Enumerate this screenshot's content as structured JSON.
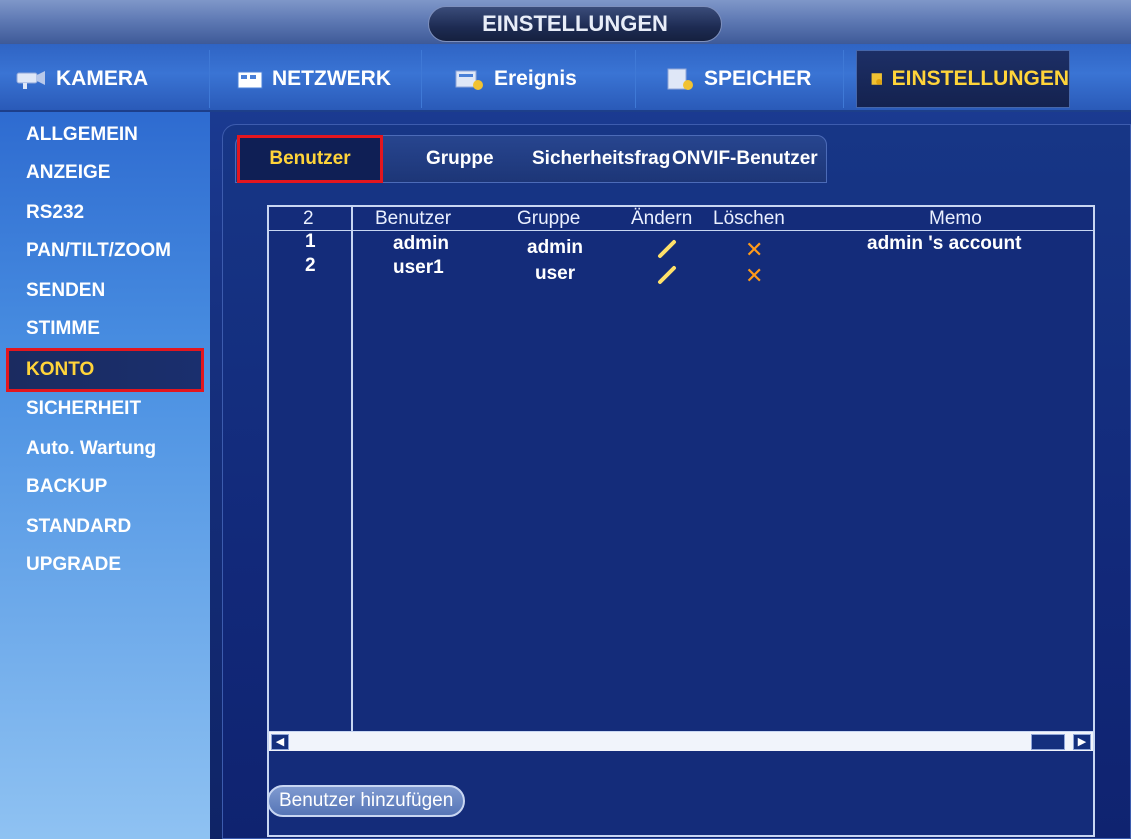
{
  "window": {
    "title": "EINSTELLUNGEN"
  },
  "main_nav": [
    {
      "label": "KAMERA",
      "icon": "camera-icon"
    },
    {
      "label": "NETZWERK",
      "icon": "network-icon"
    },
    {
      "label": "Ereignis",
      "icon": "event-icon"
    },
    {
      "label": "SPEICHER",
      "icon": "storage-icon"
    },
    {
      "label": "EINSTELLUNGEN",
      "icon": "settings-icon",
      "active": true
    }
  ],
  "sidebar": {
    "items": [
      {
        "label": "ALLGEMEIN"
      },
      {
        "label": "ANZEIGE"
      },
      {
        "label": "RS232"
      },
      {
        "label": "PAN/TILT/ZOOM"
      },
      {
        "label": "SENDEN"
      },
      {
        "label": "STIMME"
      },
      {
        "label": "KONTO",
        "active": true
      },
      {
        "label": "SICHERHEIT"
      },
      {
        "label": "Auto. Wartung"
      },
      {
        "label": "BACKUP"
      },
      {
        "label": "STANDARD"
      },
      {
        "label": "UPGRADE"
      }
    ]
  },
  "subtabs": [
    {
      "label": "Benutzer",
      "active": true
    },
    {
      "label": "Gruppe"
    },
    {
      "label": "Sicherheitsfrag"
    },
    {
      "label": "ONVIF-Benutzer"
    }
  ],
  "table": {
    "count": "2",
    "headers": {
      "user": "Benutzer",
      "group": "Gruppe",
      "edit": "Ändern",
      "delete": "Löschen",
      "memo": "Memo"
    },
    "rows": [
      {
        "index": "1",
        "user": "admin",
        "group": "admin",
        "memo": "admin 's account"
      },
      {
        "index": "2",
        "user": "user1",
        "group": "user",
        "memo": ""
      }
    ]
  },
  "actions": {
    "add_user": "Benutzer hinzufügen"
  },
  "colors": {
    "active_text": "#ffd43a",
    "highlight_outline": "#e3161e",
    "delete_icon": "#ff9a1a",
    "edit_icon": "#ffe16a"
  }
}
